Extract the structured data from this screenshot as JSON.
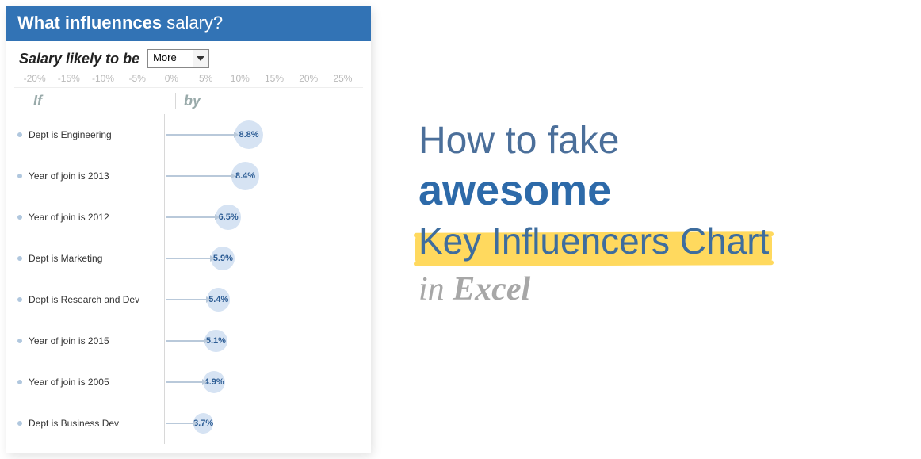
{
  "panel": {
    "title_bold": "What influennces",
    "title_light": "salary?",
    "subhead_label": "Salary likely to be",
    "select_value": "More",
    "axis_ticks": [
      "-20%",
      "-15%",
      "-10%",
      "-5%",
      "0%",
      "5%",
      "10%",
      "15%",
      "20%",
      "25%"
    ],
    "col_if": "If",
    "col_by": "by"
  },
  "chart_data": {
    "type": "bar",
    "title": "What influennces salary?",
    "xlabel": "",
    "ylabel": "",
    "xlim": [
      -20,
      25
    ],
    "categories": [
      "Dept is Engineering",
      "Year of join is 2013",
      "Year of join is 2012",
      "Dept is Marketing",
      "Dept is Research and Dev",
      "Year of join is 2015",
      "Year of join is 2005",
      "Dept is Business Dev"
    ],
    "values": [
      8.8,
      8.4,
      6.5,
      5.9,
      5.4,
      5.1,
      4.9,
      3.7
    ],
    "value_suffix": "%"
  },
  "title": {
    "l1": "How to fake",
    "l2": "awesome",
    "l3": "Key Influencers Chart",
    "l4_in": "in ",
    "l4_ex": "Excel"
  }
}
